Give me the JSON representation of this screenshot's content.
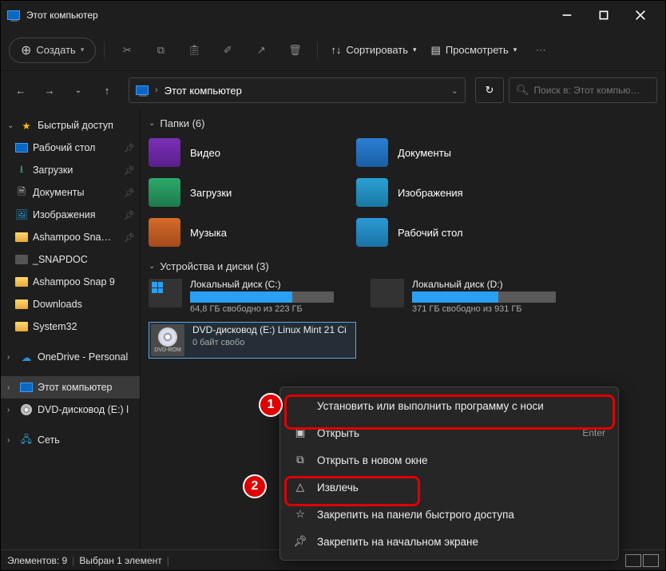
{
  "title": "Этот компьютер",
  "toolbar": {
    "new": "Создать",
    "sort": "Сортировать",
    "view": "Просмотреть"
  },
  "breadcrumb": "Этот компьютер",
  "search_placeholder": "Поиск в: Этот компью…",
  "sidebar": {
    "quick": "Быстрый доступ",
    "items": [
      "Рабочий стол",
      "Загрузки",
      "Документы",
      "Изображения",
      "Ashampoo Sna…",
      "_SNAPDOC",
      "Ashampoo Snap 9",
      "Downloads",
      "System32"
    ],
    "onedrive": "OneDrive - Personal",
    "thispc": "Этот компьютер",
    "dvd": "DVD-дисковод (E:) l",
    "network": "Сеть"
  },
  "groups": {
    "folders": "Папки (6)",
    "drives": "Устройства и диски (3)"
  },
  "folders": [
    {
      "name": "Видео",
      "cls": "ic-video"
    },
    {
      "name": "Документы",
      "cls": "ic-docs"
    },
    {
      "name": "Загрузки",
      "cls": "ic-down"
    },
    {
      "name": "Изображения",
      "cls": "ic-img"
    },
    {
      "name": "Музыка",
      "cls": "ic-music"
    },
    {
      "name": "Рабочий стол",
      "cls": "ic-desk"
    }
  ],
  "drives": [
    {
      "name": "Локальный диск (C:)",
      "free": "64,8 ГБ свободно из 223 ГБ",
      "pct": 71
    },
    {
      "name": "Локальный диск (D:)",
      "free": "371 ГБ свободно из 931 ГБ",
      "pct": 60
    }
  ],
  "dvd": {
    "name": "DVD-дисковод (E:) Linux Mint 21 Ci",
    "sub": "0 байт свобо"
  },
  "ctx": {
    "install": "Установить или выполнить программу с носи",
    "open": "Открыть",
    "open_key": "Enter",
    "open_new": "Открыть в новом окне",
    "eject": "Извлечь",
    "pin_quick": "Закрепить на панели быстрого доступа",
    "pin_start": "Закрепить на начальном экране"
  },
  "status": {
    "count": "Элементов: 9",
    "sel": "Выбран 1 элемент"
  },
  "badges": {
    "one": "1",
    "two": "2"
  }
}
